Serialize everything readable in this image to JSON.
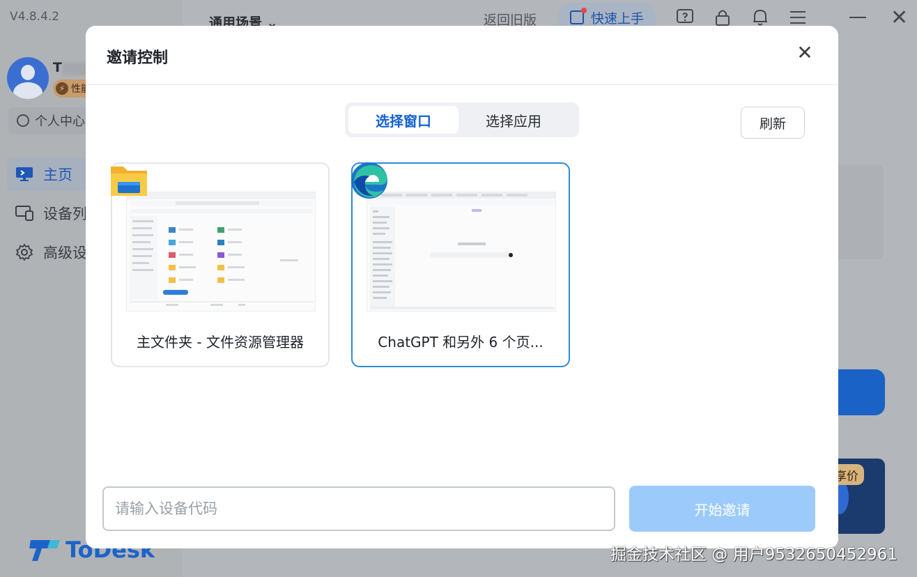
{
  "app": {
    "version": "V4.8.4.2",
    "user_name": "T",
    "badge_label": "性能",
    "profile_button": "个人中心",
    "nav": [
      {
        "label": "主页",
        "icon": "monitor-icon",
        "active": true
      },
      {
        "label": "设备列",
        "icon": "devices-icon",
        "active": false
      },
      {
        "label": "高级设",
        "icon": "gear-icon",
        "active": false
      }
    ],
    "logo_text": "ToDesk",
    "scene_label": "通用场景",
    "back_old": "返回旧版",
    "quickstart": "快速上手",
    "promo_tag": "享价"
  },
  "modal": {
    "title": "邀请控制",
    "tabs": [
      {
        "label": "选择窗口",
        "active": true
      },
      {
        "label": "选择应用",
        "active": false
      }
    ],
    "refresh_label": "刷新",
    "windows": [
      {
        "title": "主文件夹 - 文件资源管理器",
        "icon": "file-explorer-icon",
        "selected": false
      },
      {
        "title": "ChatGPT 和另外 6 个页...",
        "icon": "edge-browser-icon",
        "selected": true
      }
    ],
    "input_placeholder": "请输入设备代码",
    "start_label": "开始邀请"
  },
  "watermark": "掘金技术社区 @ 用户9532650452961",
  "colors": {
    "accent": "#1462d6",
    "selected_border": "#2e8bd8",
    "start_button_disabled": "#9ccbfb",
    "overlay": "#b3b6ba"
  }
}
